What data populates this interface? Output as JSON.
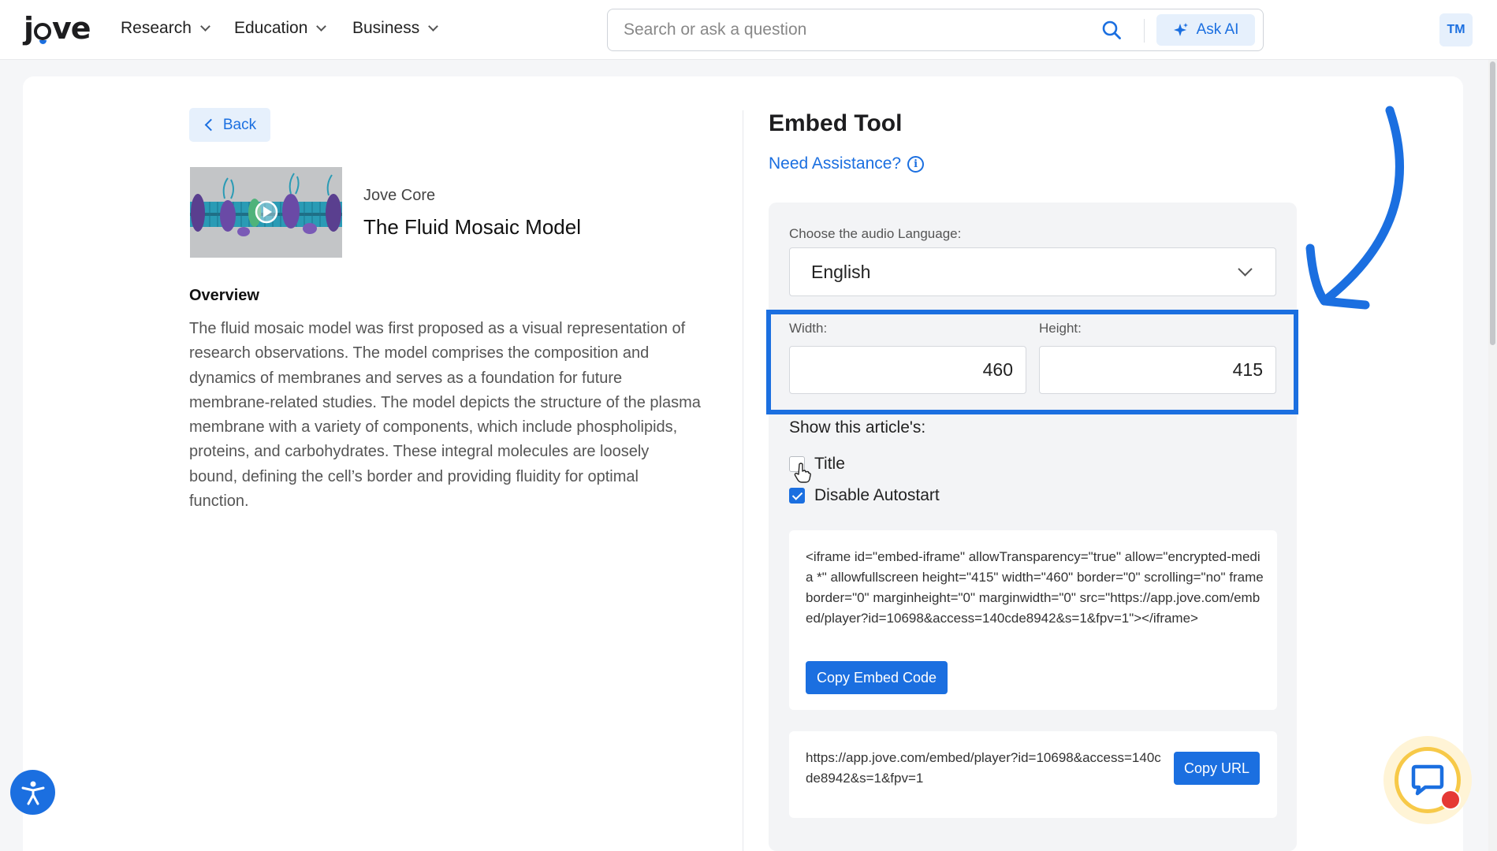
{
  "header": {
    "logo": "jove",
    "nav": [
      {
        "label": "Research"
      },
      {
        "label": "Education"
      },
      {
        "label": "Business"
      }
    ],
    "search": {
      "placeholder": "Search or ask a question",
      "value": ""
    },
    "ask_ai_label": "Ask AI",
    "avatar_initials": "TM"
  },
  "article": {
    "back_label": "Back",
    "series": "Jove Core",
    "title": "The Fluid Mosaic Model",
    "overview_heading": "Overview",
    "overview_text": "The fluid mosaic model was first proposed as a visual representation of research observations. The model comprises the composition and dynamics of membranes and serves as a foundation for future membrane-related studies. The model depicts the structure of the plasma membrane with a variety of components, which include phospholipids, proteins, and carbohydrates. These integral molecules are loosely bound, defining the cell’s border and providing fluidity for optimal function."
  },
  "embed": {
    "title": "Embed Tool",
    "assistance_label": "Need Assistance?",
    "language_label": "Choose the audio Language:",
    "language_value": "English",
    "width_label": "Width:",
    "width_value": "460",
    "height_label": "Height:",
    "height_value": "415",
    "show_label": "Show this article's:",
    "options": [
      {
        "label": "Title",
        "checked": false
      },
      {
        "label": "Disable Autostart",
        "checked": true
      }
    ],
    "embed_code": "<iframe id=\"embed-iframe\" allowTransparency=\"true\" allow=\"encrypted-media *\" allowfullscreen height=\"415\" width=\"460\" border=\"0\" scrolling=\"no\" frameborder=\"0\" marginheight=\"0\" marginwidth=\"0\" src=\"https://app.jove.com/embed/player?id=10698&access=140cde8942&s=1&fpv=1\"></iframe>",
    "copy_embed_label": "Copy Embed Code",
    "url": "https://app.jove.com/embed/player?id=10698&access=140cde8942&s=1&fpv=1",
    "copy_url_label": "Copy URL"
  },
  "colors": {
    "accent": "#1b6fe0",
    "highlight": "#1b6fe0",
    "chat_ring": "#f7c948",
    "notification": "#e53935"
  }
}
